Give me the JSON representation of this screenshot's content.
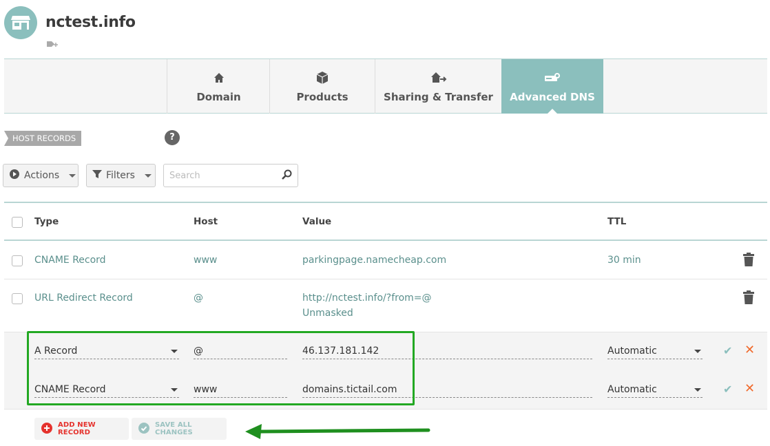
{
  "header": {
    "domain": "nctest.info"
  },
  "tabs": [
    {
      "label": "Domain",
      "active": false
    },
    {
      "label": "Products",
      "active": false
    },
    {
      "label": "Sharing & Transfer",
      "active": false
    },
    {
      "label": "Advanced DNS",
      "active": true
    }
  ],
  "section": {
    "label": "HOST RECORDS",
    "help": "?"
  },
  "toolbar": {
    "actions": "Actions",
    "filters": "Filters",
    "search_placeholder": "Search"
  },
  "table": {
    "headers": {
      "type": "Type",
      "host": "Host",
      "value": "Value",
      "ttl": "TTL"
    },
    "rows": [
      {
        "type": "CNAME Record",
        "host": "www",
        "value": "parkingpage.namecheap.com",
        "ttl": "30 min"
      },
      {
        "type": "URL Redirect Record",
        "host": "@",
        "value": "http://nctest.info/?from=@",
        "value2": "Unmasked",
        "ttl": ""
      }
    ],
    "edit_rows": [
      {
        "type": "A Record",
        "host": "@",
        "value": "46.137.181.142",
        "ttl": "Automatic"
      },
      {
        "type": "CNAME Record",
        "host": "www",
        "value": "domains.tictail.com",
        "ttl": "Automatic"
      }
    ]
  },
  "buttons": {
    "add": "ADD NEW RECORD",
    "save": "SAVE ALL CHANGES"
  },
  "colors": {
    "accent": "#8bbfbd",
    "highlight": "#22a822",
    "danger": "#f06a2c",
    "add_red": "#e5322d"
  },
  "icons": [
    "store-icon",
    "tag-add-icon",
    "home-icon",
    "box-icon",
    "house-transfer-icon",
    "server-icon",
    "play-circle-icon",
    "funnel-icon",
    "search-icon",
    "trash-icon",
    "check-icon",
    "close-icon",
    "plus-circle-icon",
    "check-circle-icon",
    "green-arrow-icon"
  ]
}
